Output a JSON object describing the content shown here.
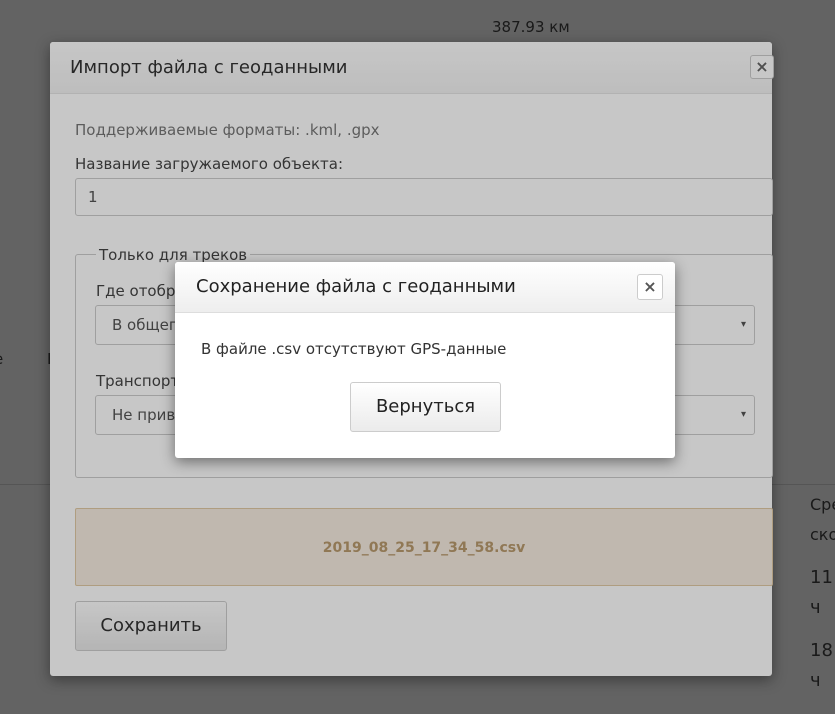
{
  "background": {
    "distance": "387.93 км",
    "left_fragment_1": "е",
    "left_fragment_2": "Е",
    "right_col_1": "Сре\nско",
    "right_col_2": "11\nч",
    "right_col_3": "18\nч"
  },
  "import_modal": {
    "title": "Импорт файла с геоданными",
    "close_icon": "×",
    "formats_text": "Поддерживаемые форматы: .kml, .gpx",
    "name_label": "Название загружаемого объекта:",
    "name_value": "1",
    "tracks_legend": "Только для треков",
    "where_label": "Где отобр",
    "where_value": "В общег",
    "transport_label": "Транспорт",
    "transport_value": "Не прив",
    "caret": "▾",
    "file_name": "2019_08_25_17_34_58.csv",
    "save_label": "Сохранить"
  },
  "alert_modal": {
    "title": "Сохранение файла с геоданными",
    "close_icon": "×",
    "message": "В файле .csv отсутствуют GPS-данные",
    "back_label": "Вернуться"
  }
}
